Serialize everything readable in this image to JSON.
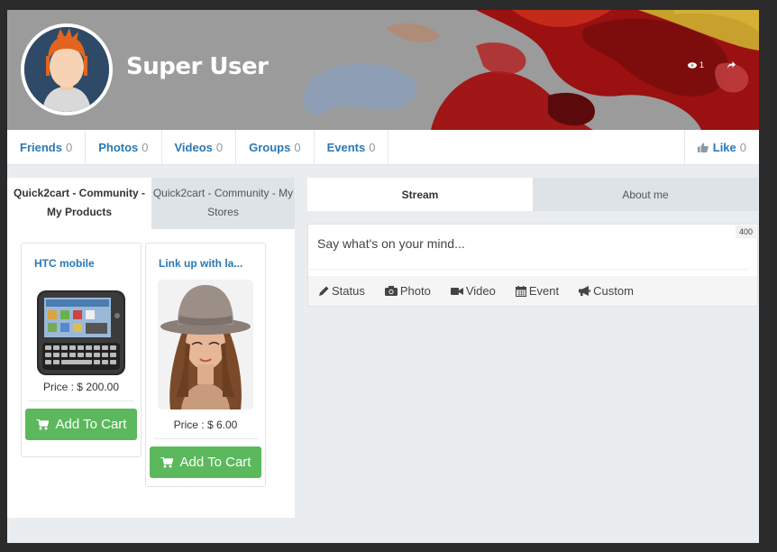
{
  "profile": {
    "name": "Super User",
    "views": "1"
  },
  "nav": {
    "items": [
      {
        "label": "Friends",
        "count": "0"
      },
      {
        "label": "Photos",
        "count": "0"
      },
      {
        "label": "Videos",
        "count": "0"
      },
      {
        "label": "Groups",
        "count": "0"
      },
      {
        "label": "Events",
        "count": "0"
      }
    ],
    "like": {
      "label": "Like",
      "count": "0"
    }
  },
  "store_tabs": {
    "active": "Quick2cart - Community - My Products",
    "inactive": "Quick2cart - Community - My Stores"
  },
  "products": [
    {
      "name": "HTC mobile",
      "price": "Price : $ 200.00",
      "button": "Add To Cart"
    },
    {
      "name": "Link up with la...",
      "price": "Price : $ 6.00",
      "button": "Add To Cart"
    }
  ],
  "stream_tabs": {
    "active": "Stream",
    "inactive": "About me"
  },
  "composer": {
    "placeholder": "Say what's on your mind...",
    "counter": "400",
    "actions": [
      "Status",
      "Photo",
      "Video",
      "Event",
      "Custom"
    ]
  },
  "colors": {
    "link": "#2a78b4",
    "cart_button": "#5cb85c",
    "page_bg": "#e9edef"
  }
}
